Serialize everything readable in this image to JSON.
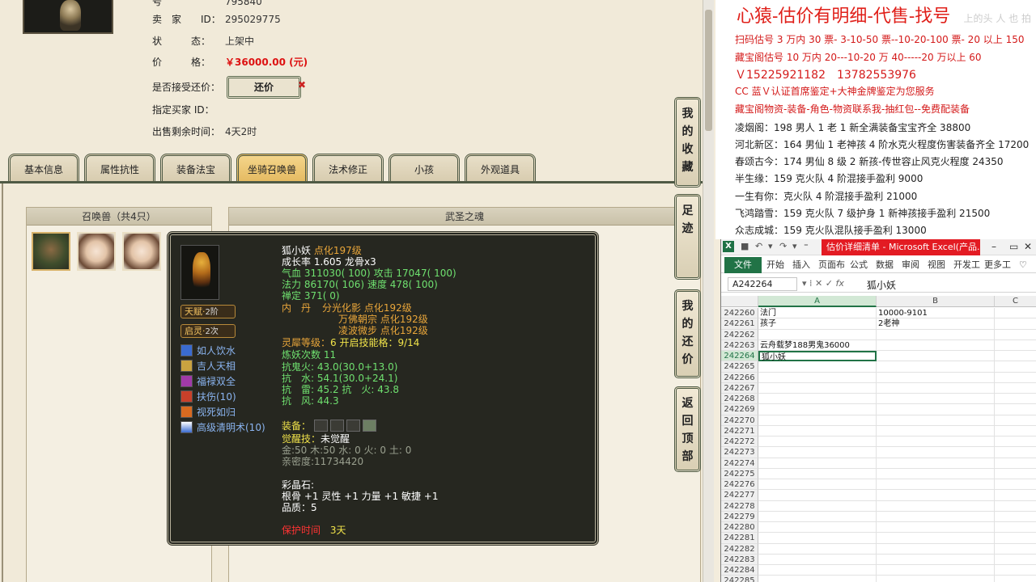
{
  "seller": {
    "top_label": "号",
    "top_value": "795840",
    "id_label": "卖　家　　ID：",
    "id_value": "295029775",
    "status_label": "状　　　态：",
    "status_value": "上架中",
    "price_label": "价　　　格：",
    "price_value": "￥36000.00 (元)",
    "bargain_label": "是否接受还价：",
    "bargain_button": "还价",
    "buyer_label": "指定买家 ID：",
    "time_label": "出售剩余时间：",
    "time_value": "4天2时"
  },
  "tabs": [
    "基本信息",
    "属性抗性",
    "装备法宝",
    "坐骑召唤兽",
    "法术修正",
    "小孩",
    "外观道具"
  ],
  "pet_panel": {
    "title": "召唤兽（共4只）"
  },
  "soul_panel": {
    "title": "武圣之魂"
  },
  "tooltip": {
    "name": "狐小妖",
    "dianhua": "点化197级",
    "growth": "成长率 1.605 龙骨x3",
    "hp_label": "气血",
    "hp": "311030( 100)",
    "atk_label": "攻击",
    "atk": "17047( 100)",
    "mp_label": "法力",
    "mp": "86170( 106)",
    "spd_label": "速度",
    "spd": "478( 100)",
    "chanding": "禅定 371( 0)",
    "neidan_label": "内　丹",
    "neidan": [
      "分光化影 点化192级",
      "万佛朝宗 点化192级",
      "凌波微步 点化192级"
    ],
    "lingxi_label": "灵犀等级：",
    "lingxi_value": "6 开启技能格：9/14",
    "lianyao": "炼妖次数 11",
    "resists": [
      "抗鬼火: 43.0(30.0+13.0)",
      "抗　水: 54.1(30.0+24.1)",
      "抗　雷: 45.2 抗　火: 43.8",
      "抗　风: 44.3"
    ],
    "badges": [
      {
        "label": "天赋",
        "level": "2阶"
      },
      {
        "label": "启灵",
        "level": "2次"
      }
    ],
    "skills": [
      "如人饮水",
      "吉人天相",
      "福禄双全",
      "扶伤(10)",
      "视死如归",
      "高级清明术(10)"
    ],
    "equip_label": "装备：",
    "awaken_label": "觉醒技：",
    "awaken_value": "未觉醒",
    "elements": "金:50 木:50 水: 0 火: 0 土: 0",
    "intimacy": "亲密度:11734420",
    "gem_label": "彩晶石:",
    "gem_attr": "根骨 +1 灵性 +1 力量 +1 敏捷 +1",
    "quality": "品质：5",
    "protect_label": "保护时间",
    "protect_value": "3天"
  },
  "side_buttons": [
    "我的收藏",
    "足迹",
    "我的还价",
    "返回顶部"
  ],
  "notes": {
    "title": "心猿-估价有明细-代售-找号",
    "lines_red": [
      "扫码估号 3 万内 30 票- 3-10-50 票--10-20-100 票- 20 以上 150",
      "藏宝阁估号 10 万内 20---10-20 万 40-----20 万以上 60",
      "Ｖ15225921182　13782553976",
      "CC 蓝Ｖ认证首席鉴定+大神金牌鉴定为您服务",
      "藏宝阁物资-装备-角色-物资联系我-抽红包--免费配装备"
    ],
    "lines": [
      "凌烟阁：198 男人 1 老 1 新全满装备宝宝齐全 38800",
      "河北新区：164 男仙 1 老神孩 4 阶水克火程度伤害装备齐全 17200",
      "春颂古今：174 男仙 8 级 2 新孩-传世容止风克火程度 24350",
      "半生缘：159 克火队 4 阶混接手盈利 9000",
      "一生有你：克火队 4 阶混接手盈利 21000",
      "飞鸿踏雪：159 克火队 7 级护身 1 新神孩接手盈利 21500",
      "众志成城：159 克火队混队接手盈利 13000"
    ],
    "watermark": "上的头 人 也 拍"
  },
  "excel": {
    "doc_title": "估价详细清单 - Microsoft Excel(产品...",
    "ribbon_tabs": [
      "文件",
      "开始",
      "插入",
      "页面布",
      "公式",
      "数据",
      "审阅",
      "视图",
      "开发工",
      "更多工"
    ],
    "name_box": "A242264",
    "formula_value": "狐小妖",
    "columns": [
      "A",
      "B",
      "C"
    ],
    "rows": [
      {
        "n": "242260",
        "a": "法门",
        "b": "10000-9101"
      },
      {
        "n": "242261",
        "a": "孩子",
        "b": "2老神"
      },
      {
        "n": "242262",
        "a": "",
        "b": ""
      },
      {
        "n": "242263",
        "a": "云舟载梦188男鬼36000",
        "b": ""
      },
      {
        "n": "242264",
        "a": "狐小妖",
        "b": ""
      },
      {
        "n": "242265",
        "a": "",
        "b": ""
      },
      {
        "n": "242266",
        "a": "",
        "b": ""
      },
      {
        "n": "242267",
        "a": "",
        "b": ""
      },
      {
        "n": "242268",
        "a": "",
        "b": ""
      },
      {
        "n": "242269",
        "a": "",
        "b": ""
      },
      {
        "n": "242270",
        "a": "",
        "b": ""
      },
      {
        "n": "242271",
        "a": "",
        "b": ""
      },
      {
        "n": "242272",
        "a": "",
        "b": ""
      },
      {
        "n": "242273",
        "a": "",
        "b": ""
      },
      {
        "n": "242274",
        "a": "",
        "b": ""
      },
      {
        "n": "242275",
        "a": "",
        "b": ""
      },
      {
        "n": "242276",
        "a": "",
        "b": ""
      },
      {
        "n": "242277",
        "a": "",
        "b": ""
      },
      {
        "n": "242278",
        "a": "",
        "b": ""
      },
      {
        "n": "242279",
        "a": "",
        "b": ""
      },
      {
        "n": "242280",
        "a": "",
        "b": ""
      },
      {
        "n": "242281",
        "a": "",
        "b": ""
      },
      {
        "n": "242282",
        "a": "",
        "b": ""
      },
      {
        "n": "242283",
        "a": "",
        "b": ""
      },
      {
        "n": "242284",
        "a": "",
        "b": ""
      },
      {
        "n": "242285",
        "a": "",
        "b": ""
      }
    ]
  }
}
